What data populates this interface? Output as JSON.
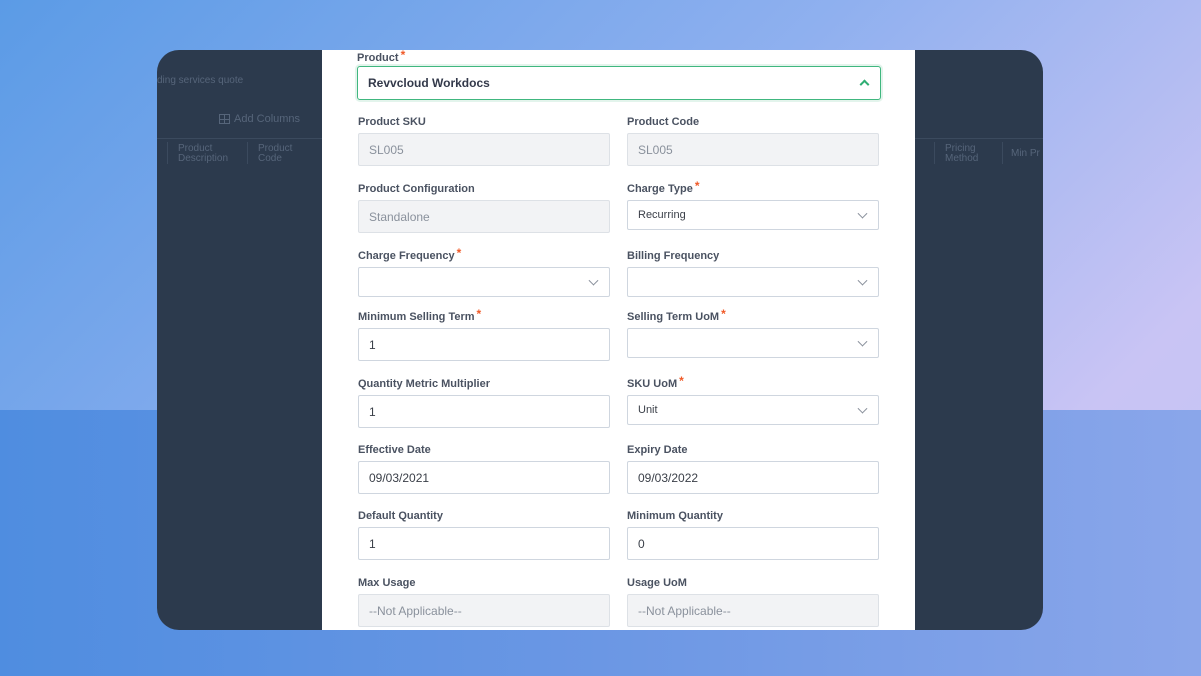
{
  "background_app": {
    "subtitle": "ding services quote",
    "add_column_label": "Add Columns",
    "columns": [
      {
        "label": "Product Description"
      },
      {
        "label": "Product Code"
      },
      {
        "label": "Pricing Method"
      },
      {
        "label": "Min Pr"
      }
    ]
  },
  "form": {
    "product": {
      "label": "Product",
      "required": "*",
      "value": "Revvcloud Workdocs"
    },
    "product_sku": {
      "label": "Product SKU",
      "value": "SL005"
    },
    "product_code": {
      "label": "Product Code",
      "value": "SL005"
    },
    "product_configuration": {
      "label": "Product Configuration",
      "value": "Standalone"
    },
    "charge_type": {
      "label": "Charge Type",
      "required": "*",
      "value": "Recurring"
    },
    "charge_frequency": {
      "label": "Charge Frequency",
      "required": "*",
      "value": ""
    },
    "billing_frequency": {
      "label": "Billing Frequency",
      "value": ""
    },
    "minimum_selling_term": {
      "label": "Minimum Selling Term",
      "required": "*",
      "value": "1"
    },
    "selling_term_uom": {
      "label": "Selling Term UoM",
      "required": "*",
      "value": ""
    },
    "quantity_metric_multiplier": {
      "label": "Quantity Metric Multiplier",
      "value": "1"
    },
    "sku_uom": {
      "label": "SKU UoM",
      "required": "*",
      "value": "Unit"
    },
    "effective_date": {
      "label": "Effective Date",
      "value": "09/03/2021"
    },
    "expiry_date": {
      "label": "Expiry Date",
      "value": "09/03/2022"
    },
    "default_quantity": {
      "label": "Default Quantity",
      "value": "1"
    },
    "minimum_quantity": {
      "label": "Minimum Quantity",
      "value": "0"
    },
    "max_usage": {
      "label": "Max Usage",
      "value": "--Not Applicable--"
    },
    "usage_uom": {
      "label": "Usage UoM",
      "value": "--Not Applicable--"
    }
  },
  "colors": {
    "accent_green": "#40b77f",
    "required_marker": "#f05a28",
    "backdrop": "#2c3a4d"
  }
}
